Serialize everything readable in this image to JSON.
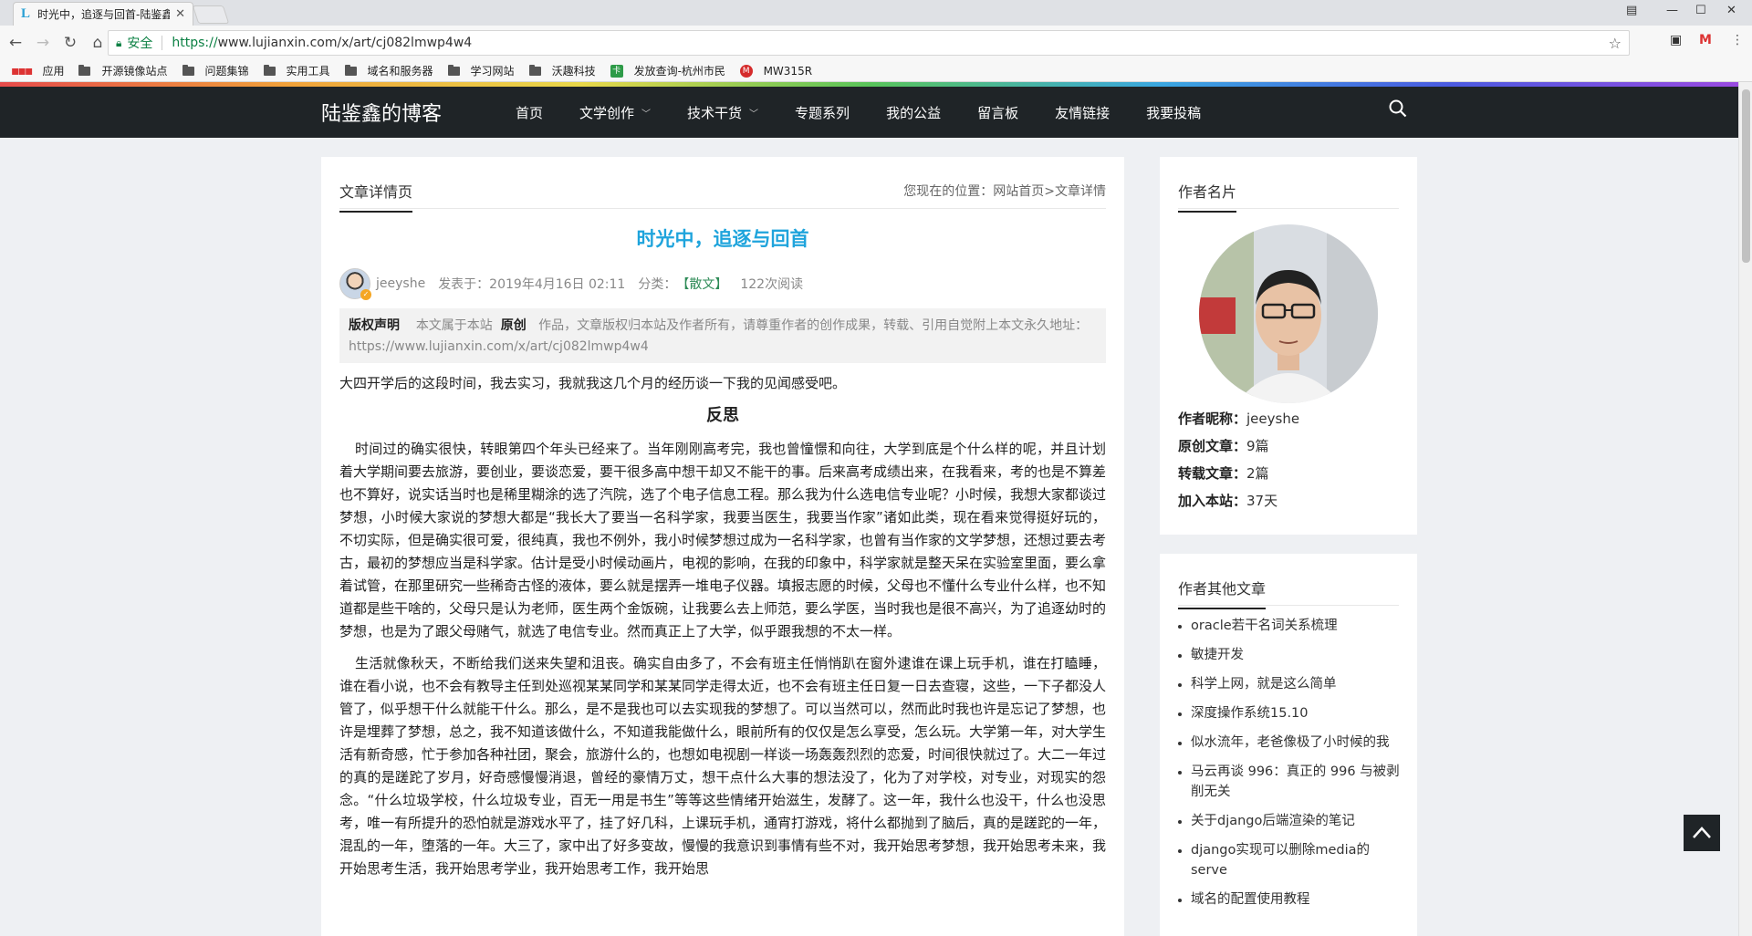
{
  "browser": {
    "tab_title": "时光中，追逐与回首-陆鉴鑫的博客",
    "secure_label": "安全",
    "url_https": "https://",
    "url_rest": "www.lujianxin.com/x/art/cj082lmwp4w4"
  },
  "bookmarks": [
    {
      "icon": "apps-icon",
      "label": "应用"
    },
    {
      "icon": "folder-icon",
      "label": "开源镜像站点"
    },
    {
      "icon": "folder-icon",
      "label": "问题集锦"
    },
    {
      "icon": "folder-icon",
      "label": "实用工具"
    },
    {
      "icon": "folder-icon",
      "label": "域名和服务器"
    },
    {
      "icon": "folder-icon",
      "label": "学习网站"
    },
    {
      "icon": "folder-icon",
      "label": "沃趣科技"
    },
    {
      "icon": "green-site-icon",
      "label": "发放查询-杭州市民卡"
    },
    {
      "icon": "red-m-icon",
      "label": "MW315R"
    }
  ],
  "site": {
    "logo": "陆鉴鑫的博客",
    "nav": [
      {
        "label": "首页",
        "caret": false
      },
      {
        "label": "文学创作",
        "caret": true
      },
      {
        "label": "技术干货",
        "caret": true
      },
      {
        "label": "专题系列",
        "caret": false
      },
      {
        "label": "我的公益",
        "caret": false
      },
      {
        "label": "留言板",
        "caret": false
      },
      {
        "label": "友情链接",
        "caret": false
      },
      {
        "label": "我要投稿",
        "caret": false
      }
    ]
  },
  "article": {
    "section_label": "文章详情页",
    "breadcrumb_prefix": "您现在的位置：",
    "breadcrumb_home": "网站首页",
    "breadcrumb_sep": ">",
    "breadcrumb_current": "文章详情",
    "title": "时光中，追逐与回首",
    "author": "jeeyshe",
    "published": "发表于：2019年4月16日 02:11",
    "category_prefix": "分类：",
    "category": "【散文】",
    "reads": "122次阅读",
    "copyright_label": "版权声明",
    "copyright_text1": "本文属于本站",
    "copyright_original": "原创",
    "copyright_text2": "作品，文章版权归本站及作者所有，请尊重作者的创作成果，转载、引用自觉附上本文永久地址：",
    "copyright_url": "https://www.lujianxin.com/x/art/cj082lmwp4w4",
    "intro": "大四开学后的这段时间，我去实习，我就我这几个月的经历谈一下我的见闻感受吧。",
    "heading": "反思",
    "para1": "时间过的确实很快，转眼第四个年头已经来了。当年刚刚高考完，我也曾憧憬和向往，大学到底是个什么样的呢，并且计划着大学期间要去旅游，要创业，要谈恋爱，要干很多高中想干却又不能干的事。后来高考成绩出来，在我看来，考的也是不算差也不算好，说实话当时也是稀里糊涂的选了汽院，选了个电子信息工程。那么我为什么选电信专业呢？小时候，我想大家都谈过梦想，小时候大家说的梦想大都是“我长大了要当一名科学家，我要当医生，我要当作家”诸如此类，现在看来觉得挺好玩的，不切实际，但是确实很可爱，很纯真，我也不例外，我小时候梦想过成为一名科学家，也曾有当作家的文学梦想，还想过要去考古，最初的梦想应当是科学家。估计是受小时候动画片，电视的影响，在我的印象中，科学家就是整天呆在实验室里面，要么拿着试管，在那里研究一些稀奇古怪的液体，要么就是摆弄一堆电子仪器。填报志愿的时候，父母也不懂什么专业什么样，也不知道都是些干啥的，父母只是认为老师，医生两个金饭碗，让我要么去上师范，要么学医，当时我也是很不高兴，为了追逐幼时的梦想，也是为了跟父母赌气，就选了电信专业。然而真正上了大学，似乎跟我想的不太一样。",
    "para2": "生活就像秋天，不断给我们送来失望和沮丧。确实自由多了，不会有班主任悄悄趴在窗外逮谁在课上玩手机，谁在打瞌睡，谁在看小说，也不会有教导主任到处巡视某某同学和某某同学走得太近，也不会有班主任日复一日去查寝，这些，一下子都没人管了，似乎想干什么就能干什么。那么，是不是我也可以去实现我的梦想了。可以当然可以，然而此时我也许是忘记了梦想，也许是埋葬了梦想，总之，我不知道该做什么，不知道我能做什么，眼前所有的仅仅是怎么享受，怎么玩。大学第一年，对大学生活有新奇感，忙于参加各种社团，聚会，旅游什么的，也想如电视剧一样谈一场轰轰烈烈的恋爱，时间很快就过了。大二一年过的真的是蹉跎了岁月，好奇感慢慢消退，曾经的豪情万丈，想干点什么大事的想法没了，化为了对学校，对专业，对现实的怨念。“什么垃圾学校，什么垃圾专业，百无一用是书生”等等这些情绪开始滋生，发酵了。这一年，我什么也没干，什么也没思考，唯一有所提升的恐怕就是游戏水平了，挂了好几科，上课玩手机，通宵打游戏，将什么都抛到了脑后，真的是蹉跎的一年，混乱的一年，堕落的一年。大三了，家中出了好多变故，慢慢的我意识到事情有些不对，我开始思考梦想，我开始思考未来，我开始思考生活，我开始思考学业，我开始思考工作，我开始思"
  },
  "sidebar": {
    "card_label": "作者名片",
    "nickname_label": "作者昵称：",
    "nickname": "jeeyshe",
    "original_label": "原创文章：",
    "original": "9篇",
    "reprint_label": "转载文章：",
    "reprint": "2篇",
    "joined_label": "加入本站：",
    "joined": "37天",
    "other_label": "作者其他文章",
    "other_articles": [
      "oracle若干名词关系梳理",
      "敏捷开发",
      "科学上网，就是这么简单",
      "深度操作系统15.10",
      "似水流年，老爸像极了小时候的我",
      "马云再谈 996：真正的 996 与被剥削无关",
      "关于django后端渲染的笔记",
      "django实现可以删除media的serve",
      "域名的配置使用教程"
    ]
  },
  "colors": {
    "header_bg": "#1f2427",
    "title_blue": "#1fa4dc",
    "category_green": "#2e8b57",
    "secure_green": "#0b8043"
  }
}
